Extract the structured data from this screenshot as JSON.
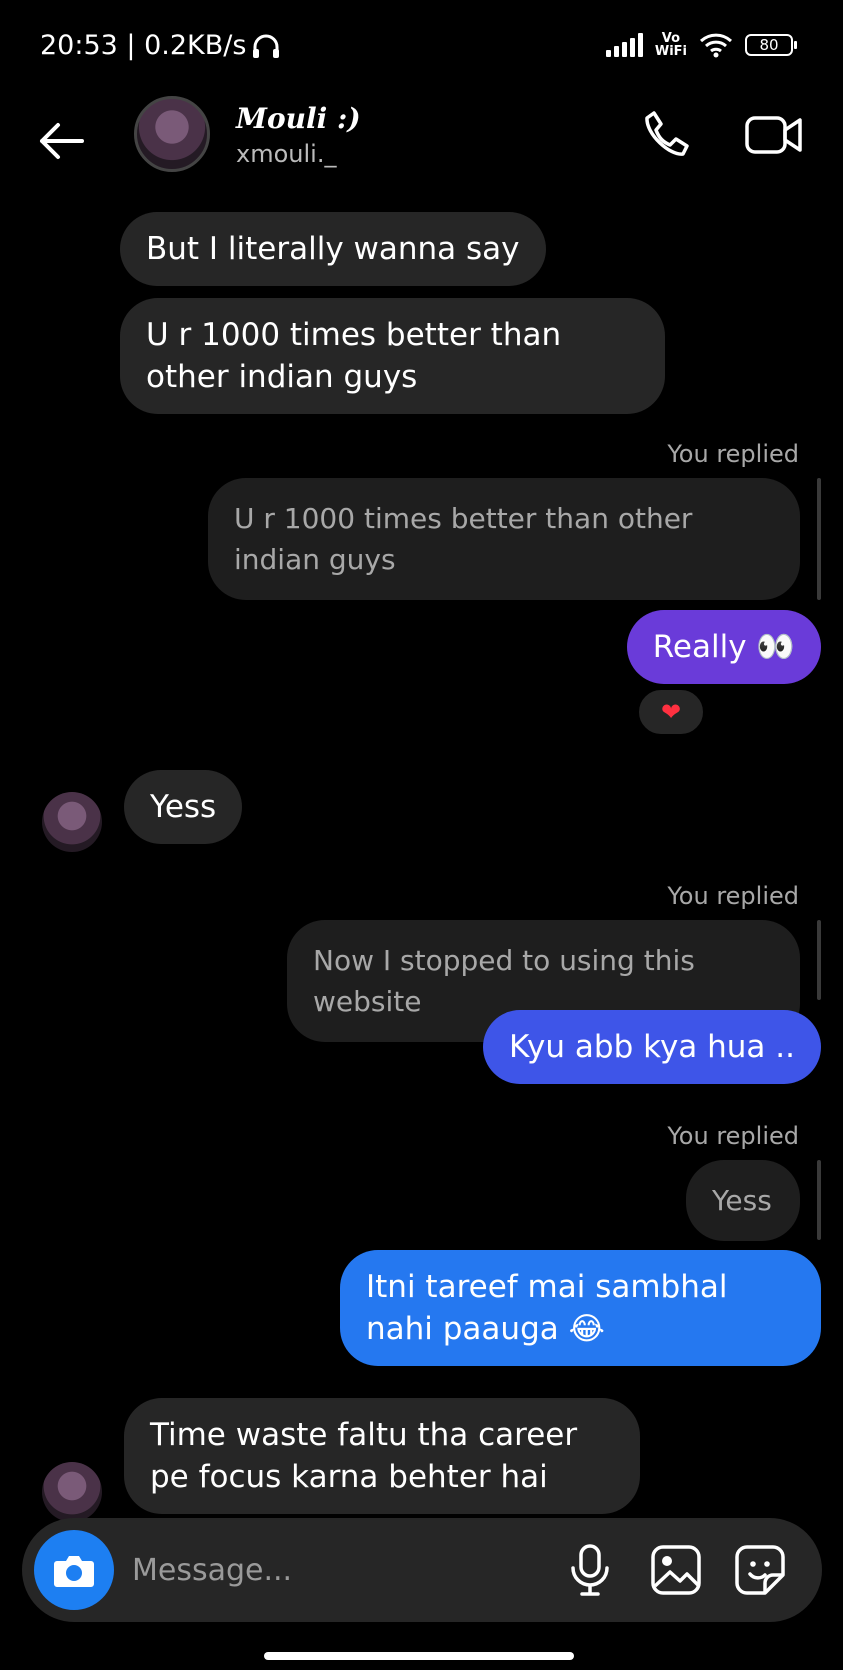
{
  "status_bar": {
    "time_speed": "20:53 | 0.2KB/s",
    "vowifi_top": "Vo",
    "vowifi_bottom": "WiFi",
    "battery": "80",
    "icons": [
      "headphones-icon",
      "signal-icon",
      "wifi-icon",
      "battery-icon"
    ]
  },
  "header": {
    "title": "Mouli :)",
    "username": "xmouli._",
    "icons": [
      "back-arrow-icon",
      "phone-call-icon",
      "video-call-icon"
    ]
  },
  "messages": [
    {
      "type": "incoming",
      "text": "But I literally wanna say"
    },
    {
      "type": "incoming",
      "text": "U r 1000 times better than other indian guys"
    },
    {
      "type": "label",
      "text": "You replied"
    },
    {
      "type": "reply_quote",
      "text": "U r 1000 times better than other indian guys"
    },
    {
      "type": "outgoing",
      "text": "Really 👀"
    },
    {
      "type": "reaction",
      "text": "❤"
    },
    {
      "type": "incoming",
      "text": "Yess"
    },
    {
      "type": "label",
      "text": "You replied"
    },
    {
      "type": "reply_quote",
      "text": "Now I stopped to using this website"
    },
    {
      "type": "outgoing",
      "text": "Kyu abb kya hua  .."
    },
    {
      "type": "label",
      "text": "You replied"
    },
    {
      "type": "reply_quote",
      "text": "Yess"
    },
    {
      "type": "outgoing",
      "text": "Itni tareef mai sambhal nahi paauga 😂"
    },
    {
      "type": "incoming",
      "text": "Time waste faltu tha career pe focus karna behter hai"
    }
  ],
  "composer": {
    "placeholder": "Message...",
    "icons": [
      "camera-icon",
      "microphone-icon",
      "gallery-icon",
      "sticker-icon"
    ]
  },
  "colors": {
    "incoming_bubble": "#262626",
    "outgoing_purple": "#6a3bd9",
    "outgoing_indigo": "#3e55e8",
    "outgoing_blue": "#2578f0",
    "camera_button": "#1d7ff2",
    "heart": "#ff3040"
  }
}
